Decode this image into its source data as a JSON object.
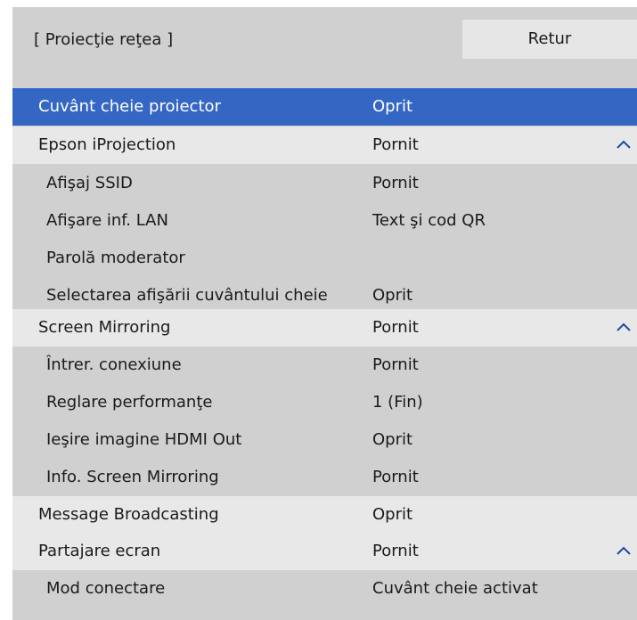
{
  "header": {
    "title": "[ Proiecţie reţea ]",
    "return_label": "Retur"
  },
  "rows": [
    {
      "label": "Cuvânt cheie proiector",
      "value": "Oprit",
      "type": "section",
      "selected": true
    },
    {
      "label": "Epson iProjection",
      "value": "Pornit",
      "type": "section",
      "expanded_icon": "chevron-up-icon"
    },
    {
      "label": "Afişaj SSID",
      "value": "Pornit",
      "type": "sub"
    },
    {
      "label": "Afişare inf. LAN",
      "value": "Text şi cod QR",
      "type": "sub"
    },
    {
      "label": "Parolă moderator",
      "value": "",
      "type": "sub"
    },
    {
      "label": "Selectarea afişării cuvântului cheie",
      "value": "Oprit",
      "type": "sub"
    },
    {
      "label": "Screen Mirroring",
      "value": "Pornit",
      "type": "section",
      "expanded_icon": "chevron-up-icon"
    },
    {
      "label": "Întrer. conexiune",
      "value": "Pornit",
      "type": "sub"
    },
    {
      "label": "Reglare performanţe",
      "value": "1 (Fin)",
      "type": "sub"
    },
    {
      "label": "Ieşire imagine HDMI Out",
      "value": "Oprit",
      "type": "sub"
    },
    {
      "label": "Info. Screen Mirroring",
      "value": "Pornit",
      "type": "sub"
    },
    {
      "label": "Message Broadcasting",
      "value": "Oprit",
      "type": "section"
    },
    {
      "label": "Partajare ecran",
      "value": "Pornit",
      "type": "section",
      "expanded_icon": "chevron-up-icon"
    },
    {
      "label": "Mod conectare",
      "value": "Cuvânt cheie activat",
      "type": "sub"
    }
  ],
  "colors": {
    "selection": "#3466c4",
    "section_row": "#e8e8e8",
    "sub_row": "#d0d0d0",
    "return_button": "#e6e6e6"
  }
}
